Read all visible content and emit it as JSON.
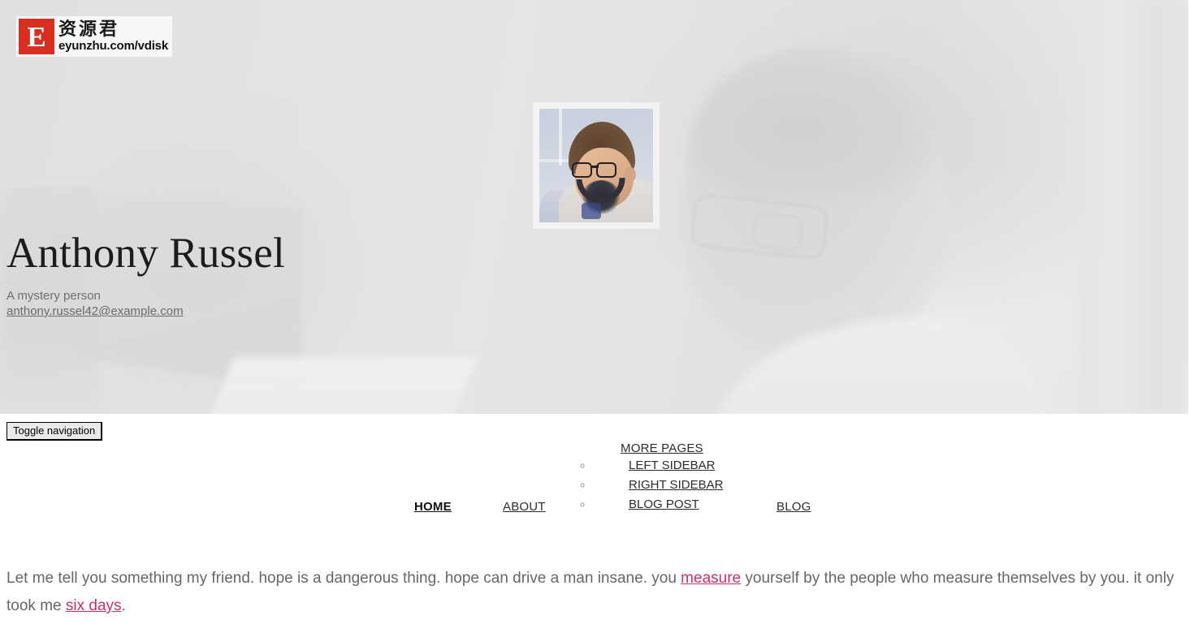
{
  "watermark": {
    "badge_letter": "E",
    "chinese_text": "资源君",
    "url_text": "eyunzhu.com/vdisk",
    "brand_color": "#d92f20"
  },
  "hero": {
    "avatar_alt": "anthony-russel-portrait",
    "name": "Anthony Russel",
    "tagline": "A mystery person",
    "email": "anthony.russel42@example.com"
  },
  "navbar": {
    "toggle_label": "Toggle navigation",
    "items": [
      {
        "label": "HOME",
        "active": true
      },
      {
        "label": "ABOUT",
        "active": false
      },
      {
        "label": "MORE PAGES",
        "active": false
      },
      {
        "label": "BLOG",
        "active": false
      }
    ],
    "dropdown": [
      {
        "label": "LEFT SIDEBAR"
      },
      {
        "label": "RIGHT SIDEBAR"
      },
      {
        "label": "BLOG POST"
      }
    ]
  },
  "main": {
    "paragraph_part1": "Let me tell you something my friend. hope is a dangerous thing. hope can drive a man insane. you ",
    "link1": "measure",
    "paragraph_part2": " yourself by the people who measure themselves by you. it only took me ",
    "link2": "six days",
    "paragraph_part3": ".",
    "link_color": "#c9316b"
  }
}
